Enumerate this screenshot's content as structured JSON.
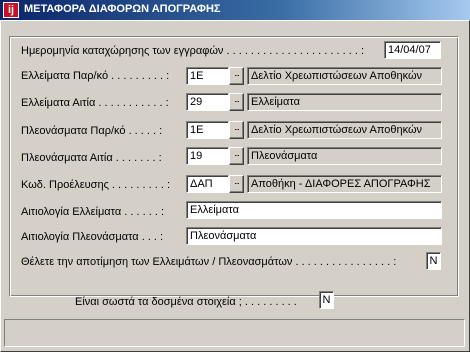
{
  "window": {
    "title": "ΜΕΤΑΦΟΡΑ ΔΙΑΦΟΡΩΝ ΑΠΟΓΡΑΦΗΣ",
    "icon_letter": "ij"
  },
  "form": {
    "date": {
      "label": "Ημερομηνία καταχώρησης των εγγραφών . . . . . . . . . . . . . . . . . . . . . . :",
      "value": "14/04/07"
    },
    "shortage_doc": {
      "label": "Ελλείματα Παρ/κό . . . . . . . . . :",
      "code": "1Ε",
      "description": "Δελτίο Χρεωπιστώσεων Αποθηκών"
    },
    "shortage_reason": {
      "label": "Ελλείματα Αιτία . . . . . . . . . . . :",
      "code": "29",
      "description": "Ελλείματα"
    },
    "surplus_doc": {
      "label": "Πλεονάσματα Παρ/κό . . . . . :",
      "code": "1Ε",
      "description": "Δελτίο Χρεωπιστώσεων Αποθηκών"
    },
    "surplus_reason": {
      "label": "Πλεονάσματα Αιτία . . . . . . . :",
      "code": "19",
      "description": "Πλεονάσματα"
    },
    "origin_code": {
      "label": "Κωδ. Προέλευσης . . . . . . . . . :",
      "code": "ΔΑΠ",
      "description": "Αποθήκη - ΔΙΑΦΟΡΕΣ ΑΠΟΓΡΑΦΗΣ"
    },
    "shortage_justification": {
      "label": "Αιτιολογία Ελλείματα . . . . . . :",
      "value": "Ελλείματα"
    },
    "surplus_justification": {
      "label": "Αιτιολογία Πλεονάσματα . . . :",
      "value": "Πλεονάσματα"
    },
    "valuation": {
      "label": "Θέλετε την αποτίμηση των Ελλειμάτων / Πλεονασμάτων . . . . . . . . . . . . . . . . :",
      "value": "Ν"
    },
    "lookup_glyph": "..."
  },
  "confirm": {
    "label": "Είναι σωστά τα δοσμένα στοιχεία ; . . . . . . . . .",
    "value": "Ν"
  },
  "status": {
    "text": ""
  }
}
